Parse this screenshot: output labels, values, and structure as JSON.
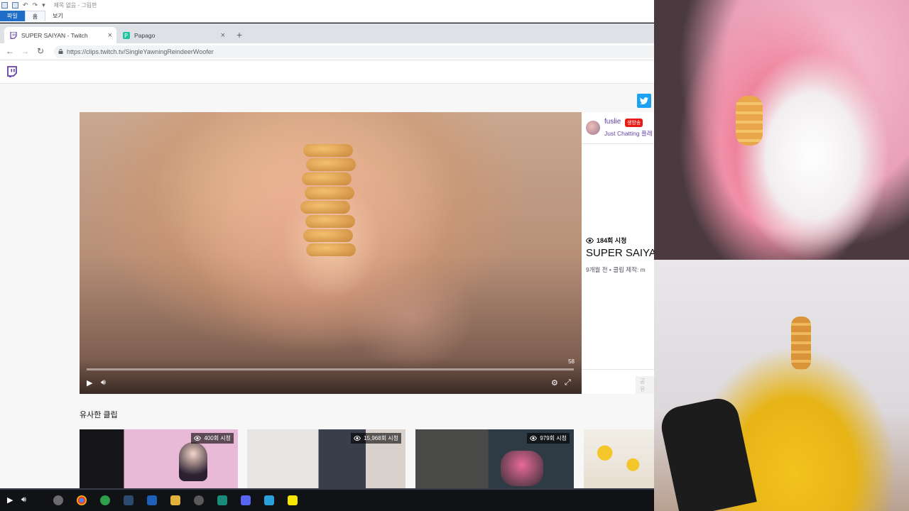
{
  "paint": {
    "title": "제목 없음 - 그림판",
    "tabs": [
      "파일",
      "홈",
      "보기"
    ]
  },
  "browser": {
    "tabs": [
      {
        "title": "SUPER SAIYAN - Twitch",
        "active": true,
        "icon": "twitch-icon"
      },
      {
        "title": "Papago",
        "active": false,
        "icon": "papago-icon"
      }
    ],
    "url": "https://clips.twitch.tv/SingleYawningReindeerWoofer"
  },
  "clip": {
    "progress": 0.0,
    "time": "58",
    "streamer": "fuslie",
    "live_badge": "생방송",
    "category": "Just Chatting 플레",
    "views": "184회 시청",
    "title": "SUPER SAIYAN",
    "meta": "9개월 전 • 클립 제작: m"
  },
  "similar": {
    "heading": "유사한 클립",
    "clips": [
      {
        "views": "400회 시청"
      },
      {
        "views": "15,968회 시청"
      },
      {
        "views": "979회 시청"
      },
      {
        "views": ""
      }
    ]
  },
  "colors": {
    "twitch_purple": "#6441a5",
    "live_red": "#e91916",
    "twitter_blue": "#1da1f2"
  }
}
